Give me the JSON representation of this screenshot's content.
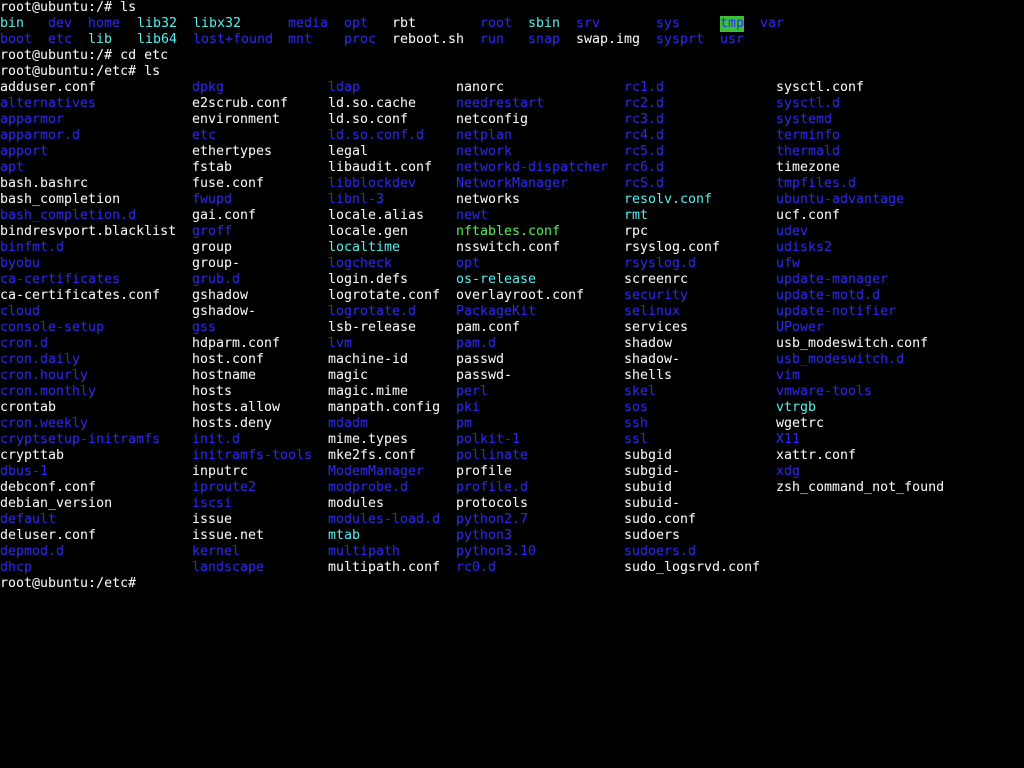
{
  "terminal": {
    "prompts": [
      "root@ubuntu:/# ls",
      "root@ubuntu:/# cd etc",
      "root@ubuntu:/etc# ls",
      "root@ubuntu:/etc#"
    ],
    "colors": {
      "background": "#000000",
      "file": "#ffffff",
      "directory": "#2c2cf0",
      "symlink": "#55f0f0",
      "executable": "#55ee55",
      "sticky_dir_bg": "#3bbf3b"
    },
    "root_ls": [
      [
        [
          "bin",
          "l"
        ],
        [
          "dev",
          "d"
        ],
        [
          "home",
          "d"
        ],
        [
          "lib32",
          "l"
        ],
        [
          "libx32",
          "l"
        ],
        [
          "media",
          "d"
        ],
        [
          "opt",
          "d"
        ],
        [
          "rbt",
          "f"
        ],
        [
          "root",
          "d"
        ],
        [
          "sbin",
          "l"
        ],
        [
          "srv",
          "d"
        ],
        [
          "sys",
          "d"
        ],
        [
          "tmp",
          "hl"
        ],
        [
          "var",
          "d"
        ]
      ],
      [
        [
          "boot",
          "d"
        ],
        [
          "etc",
          "d"
        ],
        [
          "lib",
          "l"
        ],
        [
          "lib64",
          "l"
        ],
        [
          "lost+found",
          "d"
        ],
        [
          "mnt",
          "d"
        ],
        [
          "proc",
          "d"
        ],
        [
          "reboot.sh",
          "f"
        ],
        [
          "run",
          "d"
        ],
        [
          "snap",
          "d"
        ],
        [
          "swap.img",
          "f"
        ],
        [
          "sysprt",
          "d"
        ],
        [
          "usr",
          "d"
        ]
      ]
    ],
    "etc_ls": [
      [
        [
          "adduser.conf",
          "f"
        ],
        [
          "alternatives",
          "d"
        ],
        [
          "apparmor",
          "d"
        ],
        [
          "apparmor.d",
          "d"
        ],
        [
          "apport",
          "d"
        ],
        [
          "apt",
          "d"
        ],
        [
          "bash.bashrc",
          "f"
        ],
        [
          "bash_completion",
          "f"
        ],
        [
          "bash_completion.d",
          "d"
        ],
        [
          "bindresvport.blacklist",
          "f"
        ],
        [
          "binfmt.d",
          "d"
        ],
        [
          "byobu",
          "d"
        ],
        [
          "ca-certificates",
          "d"
        ],
        [
          "ca-certificates.conf",
          "f"
        ],
        [
          "cloud",
          "d"
        ],
        [
          "console-setup",
          "d"
        ],
        [
          "cron.d",
          "d"
        ],
        [
          "cron.daily",
          "d"
        ],
        [
          "cron.hourly",
          "d"
        ],
        [
          "cron.monthly",
          "d"
        ],
        [
          "crontab",
          "f"
        ],
        [
          "cron.weekly",
          "d"
        ],
        [
          "cryptsetup-initramfs",
          "d"
        ],
        [
          "crypttab",
          "f"
        ],
        [
          "dbus-1",
          "d"
        ],
        [
          "debconf.conf",
          "f"
        ],
        [
          "debian_version",
          "f"
        ],
        [
          "default",
          "d"
        ],
        [
          "deluser.conf",
          "f"
        ],
        [
          "depmod.d",
          "d"
        ],
        [
          "dhcp",
          "d"
        ]
      ],
      [
        [
          "dpkg",
          "d"
        ],
        [
          "e2scrub.conf",
          "f"
        ],
        [
          "environment",
          "f"
        ],
        [
          "etc",
          "d"
        ],
        [
          "ethertypes",
          "f"
        ],
        [
          "fstab",
          "f"
        ],
        [
          "fuse.conf",
          "f"
        ],
        [
          "fwupd",
          "d"
        ],
        [
          "gai.conf",
          "f"
        ],
        [
          "groff",
          "d"
        ],
        [
          "group",
          "f"
        ],
        [
          "group-",
          "f"
        ],
        [
          "grub.d",
          "d"
        ],
        [
          "gshadow",
          "f"
        ],
        [
          "gshadow-",
          "f"
        ],
        [
          "gss",
          "d"
        ],
        [
          "hdparm.conf",
          "f"
        ],
        [
          "host.conf",
          "f"
        ],
        [
          "hostname",
          "f"
        ],
        [
          "hosts",
          "f"
        ],
        [
          "hosts.allow",
          "f"
        ],
        [
          "hosts.deny",
          "f"
        ],
        [
          "init.d",
          "d"
        ],
        [
          "initramfs-tools",
          "d"
        ],
        [
          "inputrc",
          "f"
        ],
        [
          "iproute2",
          "d"
        ],
        [
          "iscsi",
          "d"
        ],
        [
          "issue",
          "f"
        ],
        [
          "issue.net",
          "f"
        ],
        [
          "kernel",
          "d"
        ],
        [
          "landscape",
          "d"
        ]
      ],
      [
        [
          "ldap",
          "d"
        ],
        [
          "ld.so.cache",
          "f"
        ],
        [
          "ld.so.conf",
          "f"
        ],
        [
          "ld.so.conf.d",
          "d"
        ],
        [
          "legal",
          "f"
        ],
        [
          "libaudit.conf",
          "f"
        ],
        [
          "libblockdev",
          "d"
        ],
        [
          "libnl-3",
          "d"
        ],
        [
          "locale.alias",
          "f"
        ],
        [
          "locale.gen",
          "f"
        ],
        [
          "localtime",
          "l"
        ],
        [
          "logcheck",
          "d"
        ],
        [
          "login.defs",
          "f"
        ],
        [
          "logrotate.conf",
          "f"
        ],
        [
          "logrotate.d",
          "d"
        ],
        [
          "lsb-release",
          "f"
        ],
        [
          "lvm",
          "d"
        ],
        [
          "machine-id",
          "f"
        ],
        [
          "magic",
          "f"
        ],
        [
          "magic.mime",
          "f"
        ],
        [
          "manpath.config",
          "f"
        ],
        [
          "mdadm",
          "d"
        ],
        [
          "mime.types",
          "f"
        ],
        [
          "mke2fs.conf",
          "f"
        ],
        [
          "ModemManager",
          "d"
        ],
        [
          "modprobe.d",
          "d"
        ],
        [
          "modules",
          "f"
        ],
        [
          "modules-load.d",
          "d"
        ],
        [
          "mtab",
          "l"
        ],
        [
          "multipath",
          "d"
        ],
        [
          "multipath.conf",
          "f"
        ]
      ],
      [
        [
          "nanorc",
          "f"
        ],
        [
          "needrestart",
          "d"
        ],
        [
          "netconfig",
          "f"
        ],
        [
          "netplan",
          "d"
        ],
        [
          "network",
          "d"
        ],
        [
          "networkd-dispatcher",
          "d"
        ],
        [
          "NetworkManager",
          "d"
        ],
        [
          "networks",
          "f"
        ],
        [
          "newt",
          "d"
        ],
        [
          "nftables.conf",
          "x"
        ],
        [
          "nsswitch.conf",
          "f"
        ],
        [
          "opt",
          "d"
        ],
        [
          "os-release",
          "l"
        ],
        [
          "overlayroot.conf",
          "f"
        ],
        [
          "PackageKit",
          "d"
        ],
        [
          "pam.conf",
          "f"
        ],
        [
          "pam.d",
          "d"
        ],
        [
          "passwd",
          "f"
        ],
        [
          "passwd-",
          "f"
        ],
        [
          "perl",
          "d"
        ],
        [
          "pki",
          "d"
        ],
        [
          "pm",
          "d"
        ],
        [
          "polkit-1",
          "d"
        ],
        [
          "pollinate",
          "d"
        ],
        [
          "profile",
          "f"
        ],
        [
          "profile.d",
          "d"
        ],
        [
          "protocols",
          "f"
        ],
        [
          "python2.7",
          "d"
        ],
        [
          "python3",
          "d"
        ],
        [
          "python3.10",
          "d"
        ],
        [
          "rc0.d",
          "d"
        ]
      ],
      [
        [
          "rc1.d",
          "d"
        ],
        [
          "rc2.d",
          "d"
        ],
        [
          "rc3.d",
          "d"
        ],
        [
          "rc4.d",
          "d"
        ],
        [
          "rc5.d",
          "d"
        ],
        [
          "rc6.d",
          "d"
        ],
        [
          "rcS.d",
          "d"
        ],
        [
          "resolv.conf",
          "l"
        ],
        [
          "rmt",
          "l"
        ],
        [
          "rpc",
          "f"
        ],
        [
          "rsyslog.conf",
          "f"
        ],
        [
          "rsyslog.d",
          "d"
        ],
        [
          "screenrc",
          "f"
        ],
        [
          "security",
          "d"
        ],
        [
          "selinux",
          "d"
        ],
        [
          "services",
          "f"
        ],
        [
          "shadow",
          "f"
        ],
        [
          "shadow-",
          "f"
        ],
        [
          "shells",
          "f"
        ],
        [
          "skel",
          "d"
        ],
        [
          "sos",
          "d"
        ],
        [
          "ssh",
          "d"
        ],
        [
          "ssl",
          "d"
        ],
        [
          "subgid",
          "f"
        ],
        [
          "subgid-",
          "f"
        ],
        [
          "subuid",
          "f"
        ],
        [
          "subuid-",
          "f"
        ],
        [
          "sudo.conf",
          "f"
        ],
        [
          "sudoers",
          "f"
        ],
        [
          "sudoers.d",
          "d"
        ],
        [
          "sudo_logsrvd.conf",
          "f"
        ]
      ],
      [
        [
          "sysctl.conf",
          "f"
        ],
        [
          "sysctl.d",
          "d"
        ],
        [
          "systemd",
          "d"
        ],
        [
          "terminfo",
          "d"
        ],
        [
          "thermald",
          "d"
        ],
        [
          "timezone",
          "f"
        ],
        [
          "tmpfiles.d",
          "d"
        ],
        [
          "ubuntu-advantage",
          "d"
        ],
        [
          "ucf.conf",
          "f"
        ],
        [
          "udev",
          "d"
        ],
        [
          "udisks2",
          "d"
        ],
        [
          "ufw",
          "d"
        ],
        [
          "update-manager",
          "d"
        ],
        [
          "update-motd.d",
          "d"
        ],
        [
          "update-notifier",
          "d"
        ],
        [
          "UPower",
          "d"
        ],
        [
          "usb_modeswitch.conf",
          "f"
        ],
        [
          "usb_modeswitch.d",
          "d"
        ],
        [
          "vim",
          "d"
        ],
        [
          "vmware-tools",
          "d"
        ],
        [
          "vtrgb",
          "l"
        ],
        [
          "wgetrc",
          "f"
        ],
        [
          "X11",
          "d"
        ],
        [
          "xattr.conf",
          "f"
        ],
        [
          "xdg",
          "d"
        ],
        [
          "zsh_command_not_found",
          "f"
        ]
      ]
    ]
  }
}
